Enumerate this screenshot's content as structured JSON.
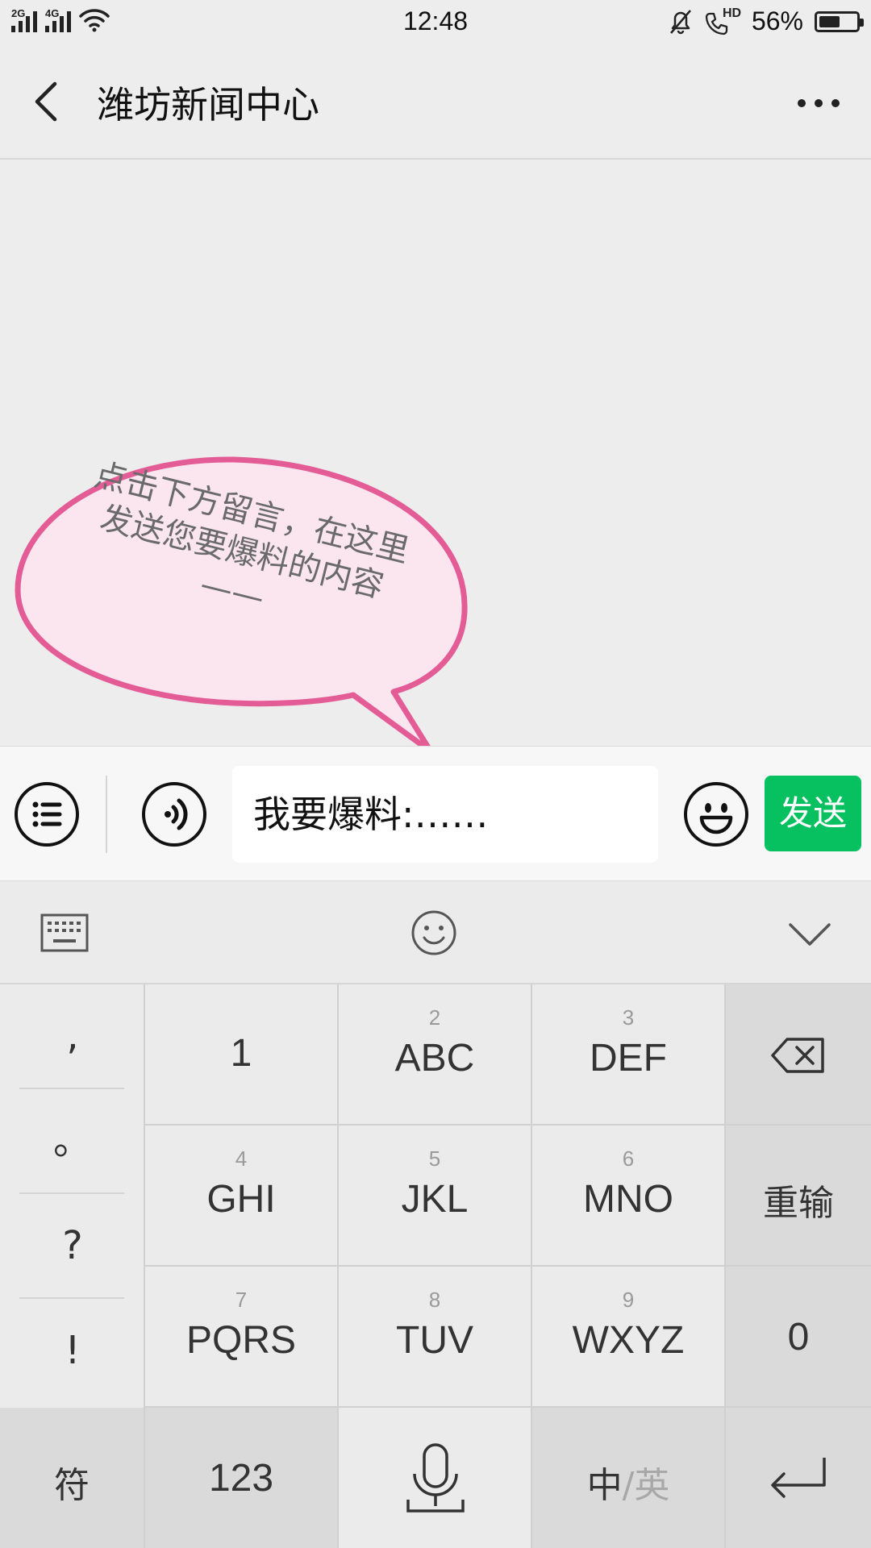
{
  "status_bar": {
    "network_1": "2G",
    "network_2": "4G",
    "time": "12:48",
    "hd_label": "HD",
    "battery_percent": "56%",
    "battery_level": 0.56
  },
  "nav": {
    "title": "潍坊新闻中心"
  },
  "bubble": {
    "text": "点击下方留言，在这里发送您要爆料的内容——",
    "border_color": "#e45c96",
    "fill_color": "#fbe6f0"
  },
  "input_bar": {
    "message_value": "我要爆料:……",
    "send_label": "发送",
    "send_color": "#07c160"
  },
  "keyboard": {
    "symbols": [
      ",",
      "。",
      "?",
      "!"
    ],
    "keys": {
      "k1": {
        "main": "1"
      },
      "k2": {
        "sup": "2",
        "main": "ABC"
      },
      "k3": {
        "sup": "3",
        "main": "DEF"
      },
      "k4": {
        "sup": "4",
        "main": "GHI"
      },
      "k5": {
        "sup": "5",
        "main": "JKL"
      },
      "k6": {
        "sup": "6",
        "main": "MNO"
      },
      "k7": {
        "sup": "7",
        "main": "PQRS"
      },
      "k8": {
        "sup": "8",
        "main": "TUV"
      },
      "k9": {
        "sup": "9",
        "main": "WXYZ"
      },
      "reenter": "重输",
      "zero": "0",
      "symbol": "符",
      "num": "123",
      "lang_cn": "中",
      "lang_sep": "/",
      "lang_en": "英"
    }
  },
  "icons": {
    "status": [
      "signal-icon",
      "wifi-icon",
      "mute-bell-icon",
      "hd-call-icon",
      "battery-icon"
    ],
    "nav": [
      "back-icon",
      "more-icon"
    ],
    "input": [
      "menu-list-icon",
      "voice-icon",
      "emoji-icon"
    ],
    "keyboard": [
      "keyboard-icon",
      "smiley-icon",
      "chevron-down-icon",
      "backspace-icon",
      "microphone-icon",
      "enter-icon"
    ]
  }
}
